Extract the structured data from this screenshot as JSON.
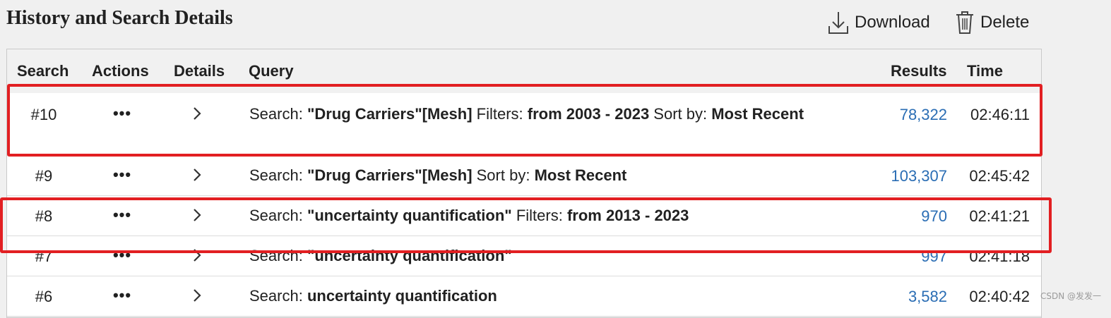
{
  "page": {
    "title": "History and Search Details",
    "watermark": "CSDN @发发一"
  },
  "toolbar": {
    "download_label": "Download",
    "download_icon": "download-icon",
    "delete_label": "Delete",
    "delete_icon": "trash-icon"
  },
  "table": {
    "columns": {
      "search": "Search",
      "actions": "Actions",
      "details": "Details",
      "query": "Query",
      "results": "Results",
      "time": "Time"
    },
    "actions_glyph": "•••",
    "rows": [
      {
        "search": "#10",
        "query_parts": {
          "p1": "Search: ",
          "b1": "\"Drug Carriers\"[Mesh]",
          "p2": " Filters: ",
          "b2": "from 2003 - 2023",
          "p3": " Sort by: ",
          "b3": "Most Recent"
        },
        "results": "78,322",
        "time": "02:46:11",
        "highlighted": true
      },
      {
        "search": "#9",
        "query_parts": {
          "p1": "Search: ",
          "b1": "\"Drug Carriers\"[Mesh]",
          "p2": " Sort by: ",
          "b2": "Most Recent"
        },
        "results": "103,307",
        "time": "02:45:42",
        "highlighted": false
      },
      {
        "search": "#8",
        "query_parts": {
          "p1": "Search: ",
          "b1": "\"uncertainty quantification\"",
          "p2": " Filters: ",
          "b2": "from 2013 - 2023"
        },
        "results": "970",
        "time": "02:41:21",
        "highlighted": true
      },
      {
        "search": "#7",
        "query_parts": {
          "p1": "Search: ",
          "b1": "\"uncertainty quantification\""
        },
        "results": "997",
        "time": "02:41:18",
        "highlighted": false
      },
      {
        "search": "#6",
        "query_parts": {
          "p1": "Search: ",
          "b1": "uncertainty quantification"
        },
        "results": "3,582",
        "time": "02:40:42",
        "highlighted": false
      }
    ]
  },
  "colors": {
    "link": "#2a6db4",
    "highlight_border": "#e21f22",
    "background": "#f0f0f0"
  }
}
